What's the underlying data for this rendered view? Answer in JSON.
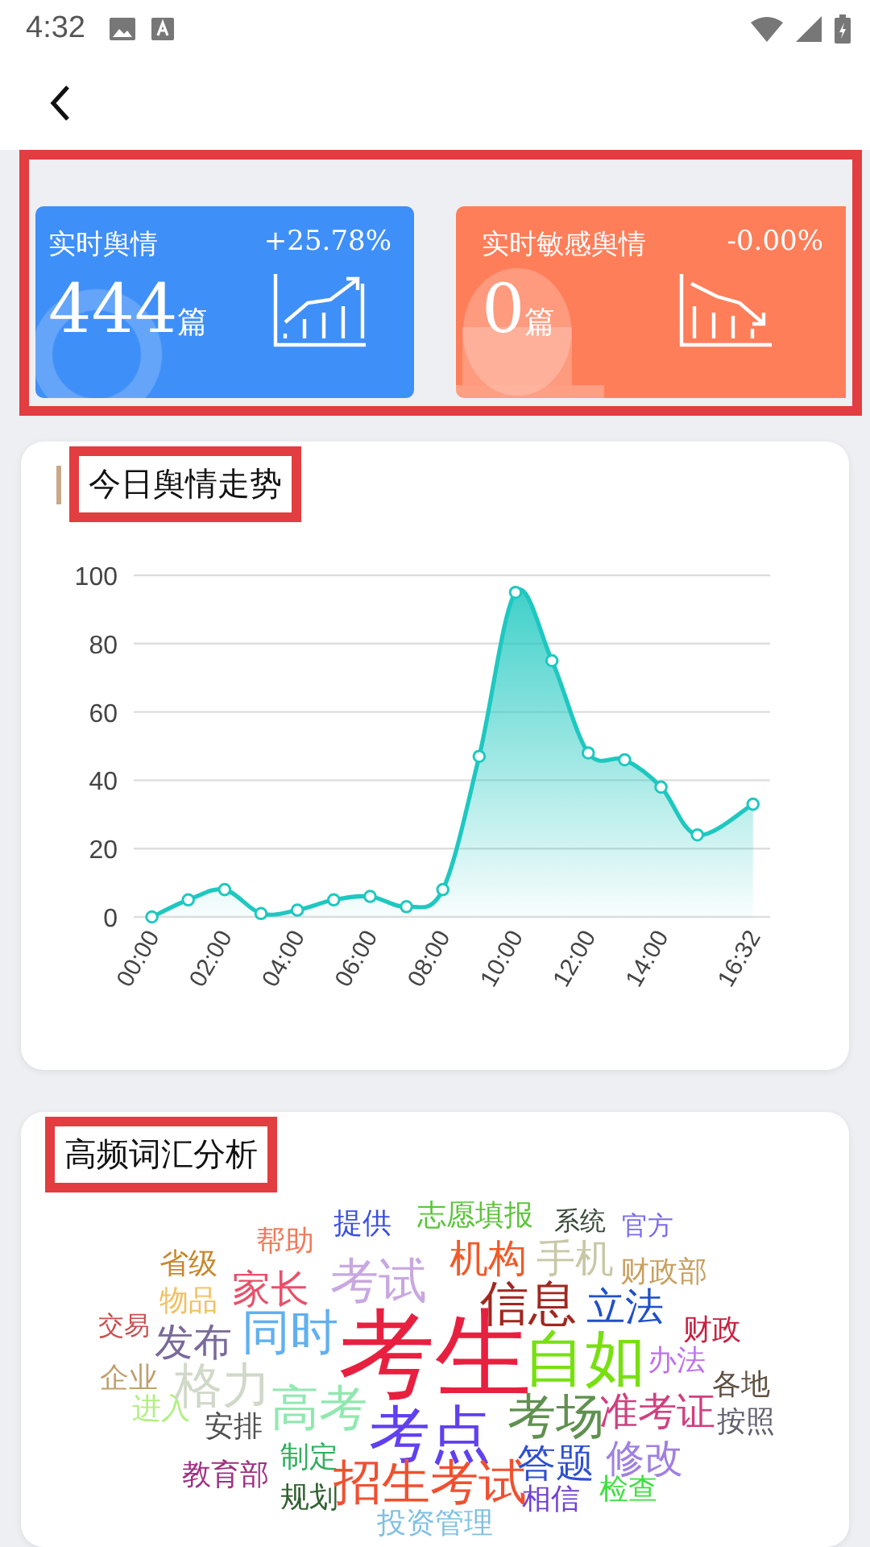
{
  "status_bar": {
    "time": "4:32"
  },
  "summary_cards": [
    {
      "kind": "rising",
      "title": "实时舆情",
      "change": "+25.78%",
      "count": "444",
      "unit": "篇"
    },
    {
      "kind": "falling",
      "title": "实时敏感舆情",
      "change": "-0.00%",
      "count": "0",
      "unit": "篇"
    }
  ],
  "trend_card": {
    "title": "今日舆情走势",
    "chart_data": {
      "type": "area",
      "grid": true,
      "x": [
        0,
        1,
        2,
        3,
        4,
        5,
        6,
        7,
        8,
        9,
        10,
        11,
        12,
        13,
        14,
        15,
        16.53
      ],
      "series": [
        {
          "color": "#1ec8c0",
          "values": [
            0,
            5,
            8,
            1,
            2,
            5,
            6,
            3,
            8,
            47,
            95,
            75,
            48,
            46,
            38,
            24,
            33
          ]
        }
      ],
      "xlim": [
        -0.5,
        17
      ],
      "ylim": [
        0,
        100
      ],
      "yticks": [
        0,
        20,
        40,
        60,
        80,
        100
      ],
      "xticks": [
        {
          "value": 0,
          "label": "00:00"
        },
        {
          "value": 2,
          "label": "02:00"
        },
        {
          "value": 4,
          "label": "04:00"
        },
        {
          "value": 6,
          "label": "06:00"
        },
        {
          "value": 8,
          "label": "08:00"
        },
        {
          "value": 10,
          "label": "10:00"
        },
        {
          "value": 12,
          "label": "12:00"
        },
        {
          "value": 14,
          "label": "14:00"
        },
        {
          "value": 16.53,
          "label": "16:32"
        }
      ]
    }
  },
  "word_cloud": {
    "title": "高频词汇分析",
    "words": [
      {
        "text": "提供",
        "color": "#3b4fe0",
        "kind": "sm"
      },
      {
        "text": "志愿填报",
        "color": "#5cc43a",
        "kind": "sm"
      },
      {
        "text": "系统",
        "color": "#3a4a3a",
        "kind": "xs"
      },
      {
        "text": "官方",
        "color": "#7a6cf0",
        "kind": "xs"
      },
      {
        "text": "省级",
        "color": "#c8862a",
        "kind": "sm"
      },
      {
        "text": "帮助",
        "color": "#f07a5a",
        "kind": "sm"
      },
      {
        "text": "考试",
        "color": "#c8a8e0",
        "kind": "lg"
      },
      {
        "text": "机构",
        "color": "#f05a28",
        "kind": "md"
      },
      {
        "text": "手机",
        "color": "#c8c8a8",
        "kind": "md"
      },
      {
        "text": "财政部",
        "color": "#c8a060",
        "kind": "sm"
      },
      {
        "text": "物品",
        "color": "#f0c060",
        "kind": "sm"
      },
      {
        "text": "家长",
        "color": "#e8506a",
        "kind": "md"
      },
      {
        "text": "信息",
        "color": "#a02820",
        "kind": "lg"
      },
      {
        "text": "立法",
        "color": "#2050c8",
        "kind": "md"
      },
      {
        "text": "交易",
        "color": "#c85050",
        "kind": "xs"
      },
      {
        "text": "发布",
        "color": "#7a6a9a",
        "kind": "md"
      },
      {
        "text": "同时",
        "color": "#60b0f0",
        "kind": "lg"
      },
      {
        "text": "考生",
        "color": "#e82040",
        "kind": "huge"
      },
      {
        "text": "自如",
        "color": "#78e010",
        "kind": "xl"
      },
      {
        "text": "办法",
        "color": "#c070f0",
        "kind": "sm"
      },
      {
        "text": "财政",
        "color": "#c82040",
        "kind": "sm"
      },
      {
        "text": "企业",
        "color": "#c0a070",
        "kind": "sm"
      },
      {
        "text": "进入",
        "color": "#b0f080",
        "kind": "sm"
      },
      {
        "text": "格力",
        "color": "#d0d8c8",
        "kind": "lg"
      },
      {
        "text": "安排",
        "color": "#505050",
        "kind": "sm"
      },
      {
        "text": "高考",
        "color": "#90e8b0",
        "kind": "lg"
      },
      {
        "text": "考点",
        "color": "#6040f0",
        "kind": "xl"
      },
      {
        "text": "考场",
        "color": "#609050",
        "kind": "lg"
      },
      {
        "text": "准考证",
        "color": "#d04080",
        "kind": "md"
      },
      {
        "text": "各地",
        "color": "#605040",
        "kind": "sm"
      },
      {
        "text": "按照",
        "color": "#606070",
        "kind": "sm"
      },
      {
        "text": "教育部",
        "color": "#a03080",
        "kind": "sm"
      },
      {
        "text": "制定",
        "color": "#30b060",
        "kind": "sm"
      },
      {
        "text": "规划",
        "color": "#306030",
        "kind": "sm"
      },
      {
        "text": "招生考试",
        "color": "#f05030",
        "kind": "lg"
      },
      {
        "text": "答题",
        "color": "#3050d0",
        "kind": "md"
      },
      {
        "text": "相信",
        "color": "#7040d0",
        "kind": "sm"
      },
      {
        "text": "修改",
        "color": "#a080e0",
        "kind": "md"
      },
      {
        "text": "检查",
        "color": "#40e040",
        "kind": "sm"
      },
      {
        "text": "投资管理",
        "color": "#80c0e0",
        "kind": "sm"
      }
    ]
  }
}
